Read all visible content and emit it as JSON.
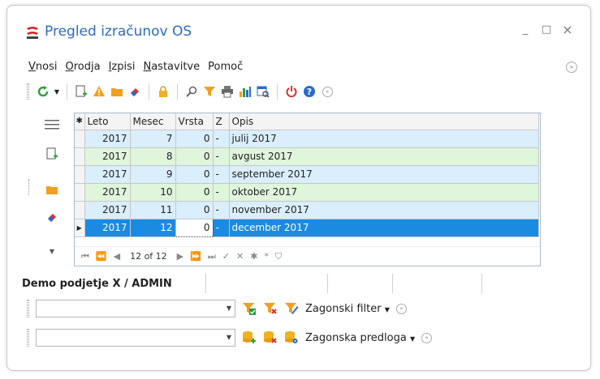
{
  "window": {
    "title": "Pregled izračunov OS",
    "minimize_glyph": "_",
    "maximize_glyph": "□",
    "close_glyph": "×"
  },
  "menu": {
    "items": [
      {
        "accel": "V",
        "rest": "nosi"
      },
      {
        "accel": "O",
        "rest": "rodja"
      },
      {
        "accel": "I",
        "rest": "zpisi"
      },
      {
        "accel": "N",
        "rest": "astavitve"
      },
      {
        "accel": "",
        "rest": "Pomoč"
      }
    ]
  },
  "grid": {
    "columns": [
      "Leto",
      "Mesec",
      "Vrsta",
      "Z",
      "Opis"
    ],
    "rows": [
      {
        "leto": "2017",
        "mesec": "7",
        "vrsta": "0",
        "z": "-",
        "opis": "julij 2017"
      },
      {
        "leto": "2017",
        "mesec": "8",
        "vrsta": "0",
        "z": "-",
        "opis": "avgust 2017"
      },
      {
        "leto": "2017",
        "mesec": "9",
        "vrsta": "0",
        "z": "-",
        "opis": "september 2017"
      },
      {
        "leto": "2017",
        "mesec": "10",
        "vrsta": "0",
        "z": "-",
        "opis": "oktober 2017"
      },
      {
        "leto": "2017",
        "mesec": "11",
        "vrsta": "0",
        "z": "-",
        "opis": "november 2017"
      },
      {
        "leto": "2017",
        "mesec": "12",
        "vrsta": "0",
        "z": "-",
        "opis": "december 2017"
      }
    ],
    "selected_row": 5,
    "navigator": {
      "position": "12 of 12"
    }
  },
  "status": {
    "company_user": "Demo podjetje X / ADMIN"
  },
  "filter": {
    "combo_value": "",
    "label": "Zagonski filter"
  },
  "template": {
    "combo_value": "",
    "label": "Zagonska predloga"
  },
  "colors": {
    "title": "#2b6cc4",
    "row_even": "#daeefc",
    "row_odd": "#dff5dc",
    "row_selected": "#1b8ae3"
  }
}
